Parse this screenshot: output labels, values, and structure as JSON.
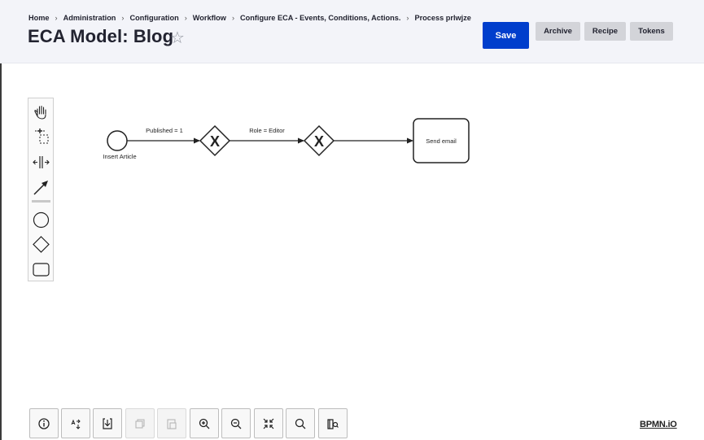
{
  "breadcrumb": {
    "items": [
      "Home",
      "Administration",
      "Configuration",
      "Workflow",
      "Configure ECA - Events, Conditions, Actions.",
      "Process prlwjze"
    ],
    "separator": "›"
  },
  "page": {
    "title": "ECA Model: Blog",
    "star": "☆"
  },
  "actions": {
    "save": "Save",
    "archive": "Archive",
    "recipe": "Recipe",
    "tokens": "Tokens"
  },
  "palette": {
    "tools": [
      "hand-tool",
      "lasso-tool",
      "space-tool",
      "global-connect-tool",
      "create-start-event",
      "create-gateway",
      "create-task"
    ]
  },
  "diagram": {
    "start_event": "Insert Article",
    "flow_1_label": "Published = 1",
    "gateway_1_marker": "X",
    "flow_2_label": "Role = Editor",
    "gateway_2_marker": "X",
    "task": "Send email"
  },
  "bottom_toolbar": {
    "buttons": [
      "info",
      "layout",
      "download",
      "copy",
      "paste",
      "zoom-in",
      "zoom-out",
      "fit",
      "search",
      "minimap"
    ],
    "disabled": [
      "copy",
      "paste"
    ]
  },
  "logo": "BPMN.iO",
  "colors": {
    "header_bg": "#f3f4f9",
    "save_bg": "#003ecc",
    "secondary_btn_bg": "#d3d4d9"
  }
}
